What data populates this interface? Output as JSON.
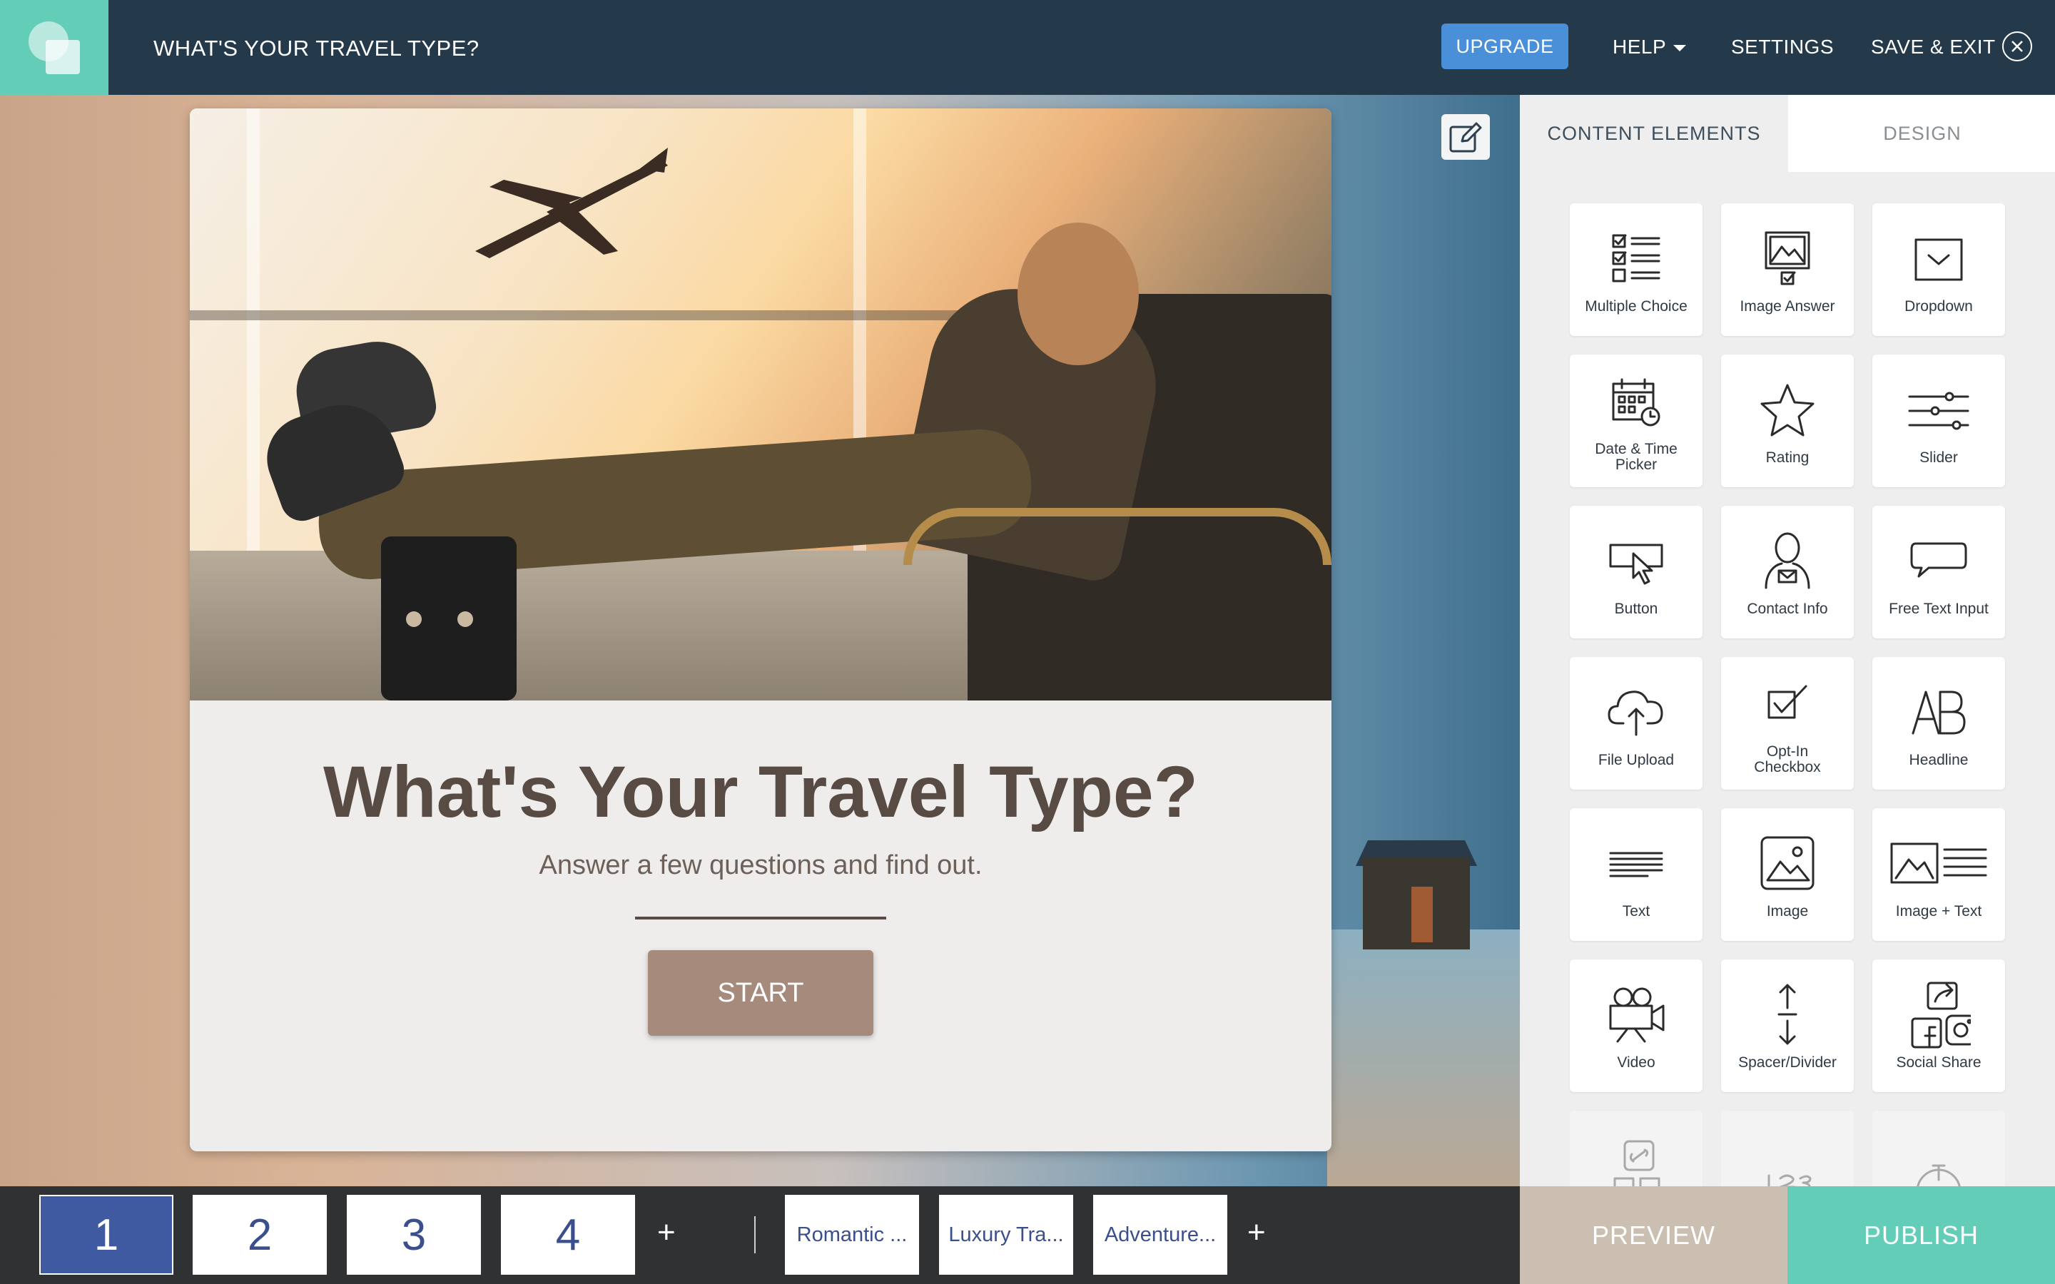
{
  "header": {
    "title": "WHAT'S YOUR TRAVEL TYPE?",
    "upgrade_label": "UPGRADE",
    "help_label": "HELP",
    "settings_label": "SETTINGS",
    "save_exit_label": "SAVE & EXIT"
  },
  "quiz": {
    "title": "What's Your Travel Type?",
    "subtitle": "Answer a few questions and find out.",
    "start_label": "START"
  },
  "panel": {
    "tabs": [
      {
        "label": "CONTENT ELEMENTS",
        "active": true
      },
      {
        "label": "DESIGN",
        "active": false
      }
    ],
    "elements": [
      {
        "label": "Multiple Choice",
        "icon": "multiple-choice-icon"
      },
      {
        "label": "Image Answer",
        "icon": "image-answer-icon"
      },
      {
        "label": "Dropdown",
        "icon": "dropdown-icon"
      },
      {
        "label": "Date & Time Picker",
        "icon": "calendar-icon"
      },
      {
        "label": "Rating",
        "icon": "star-icon"
      },
      {
        "label": "Slider",
        "icon": "slider-icon"
      },
      {
        "label": "Button",
        "icon": "button-cursor-icon"
      },
      {
        "label": "Contact Info",
        "icon": "contact-icon"
      },
      {
        "label": "Free Text Input",
        "icon": "speech-bubble-icon"
      },
      {
        "label": "File Upload",
        "icon": "cloud-upload-icon"
      },
      {
        "label": "Opt-In Checkbox",
        "icon": "checkbox-icon"
      },
      {
        "label": "Headline",
        "icon": "headline-icon"
      },
      {
        "label": "Text",
        "icon": "text-lines-icon"
      },
      {
        "label": "Image",
        "icon": "image-icon"
      },
      {
        "label": "Image + Text",
        "icon": "image-text-icon"
      },
      {
        "label": "Video",
        "icon": "video-camera-icon"
      },
      {
        "label": "Spacer/Divider",
        "icon": "spacer-icon"
      },
      {
        "label": "Social Share",
        "icon": "social-share-icon"
      }
    ]
  },
  "footer": {
    "pages": [
      "1",
      "2",
      "3",
      "4"
    ],
    "add_label": "+",
    "results": [
      "Romantic ...",
      "Luxury Tra...",
      "Adventure..."
    ],
    "preview_label": "PREVIEW",
    "publish_label": "PUBLISH"
  },
  "colors": {
    "topbar": "#243a4a",
    "brand": "#63cdb7",
    "upgrade": "#4a90d9",
    "active_page": "#3f5aa0",
    "start_button": "#a68a7c",
    "preview": "#cbbfb2"
  }
}
